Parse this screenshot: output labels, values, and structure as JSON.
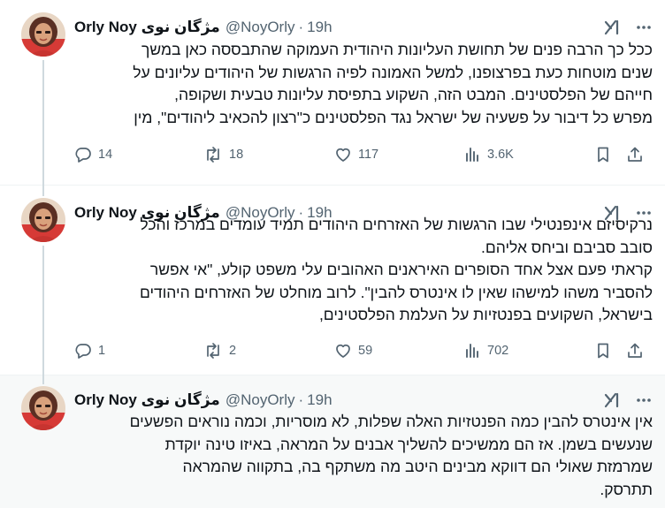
{
  "tweets": [
    {
      "name": "Orly Noy مژگان نوی",
      "handle": "@NoyOrly",
      "time": "19h",
      "lines": [
        "ככל כך הרבה פנים של תחושת העליונות היהודית העמוקה שהתבססה כאן במשך",
        "שנים מוטחות כעת בפרצופנו, למשל האמונה לפיה הרגשות של היהודים עליונים על",
        "חייהם של הפלסטינים. המבט הזה, השקוע בתפיסת עליונות טבעית ושקופה,",
        "מפרש כל דיבור על פשעיה של ישראל נגד הפלסטינים כ\"רצון להכאיב ליהודים\", מין"
      ],
      "stats": {
        "replies": "14",
        "reposts": "18",
        "likes": "117",
        "views": "3.6K"
      }
    },
    {
      "name": "Orly Noy مژگان نوی",
      "handle": "@NoyOrly",
      "time": "19h",
      "lines": [
        "נרקיסיזם אינפנטילי שבו הרגשות של האזרחים היהודים תמיד עומדים במרכז והכל",
        "סובב סביבם וביחס אליהם.",
        "קראתי פעם אצל אחד הסופרים האיראנים האהובים עלי משפט קולע, \"אי אפשר",
        "להסביר משהו למישהו שאין לו אינטרס להבין\". לרוב מוחלט של האזרחים היהודים",
        "בישראל, השקועים בפנטזיות על העלמת הפלסטינים,"
      ],
      "stats": {
        "replies": "1",
        "reposts": "2",
        "likes": "59",
        "views": "702"
      }
    },
    {
      "name": "Orly Noy مژگان نوی",
      "handle": "@NoyOrly",
      "time": "19h",
      "lines": [
        "אין אינטרס להבין כמה הפנטזיות האלה שפלות, לא מוסריות, וכמה נוראים הפשעים",
        "שנעשים בשמן. אז הם ממשיכים להשליך אבנים על המראה, באיזו טינה יוקדת",
        "שמרמזת שאולי הם דווקא מבינים היטב מה משתקף בה, בתקווה שהמראה",
        "תתרסק."
      ]
    }
  ],
  "icons": {
    "grok": "grok-icon",
    "more": "more-icon",
    "reply": "reply-icon",
    "repost": "repost-icon",
    "like": "heart-icon",
    "views": "views-icon",
    "bookmark": "bookmark-icon",
    "share": "share-icon"
  },
  "colors": {
    "text": "#0f1419",
    "secondary": "#536471",
    "divider": "#eff3f4",
    "highlight_bg": "#f7f9f9"
  }
}
